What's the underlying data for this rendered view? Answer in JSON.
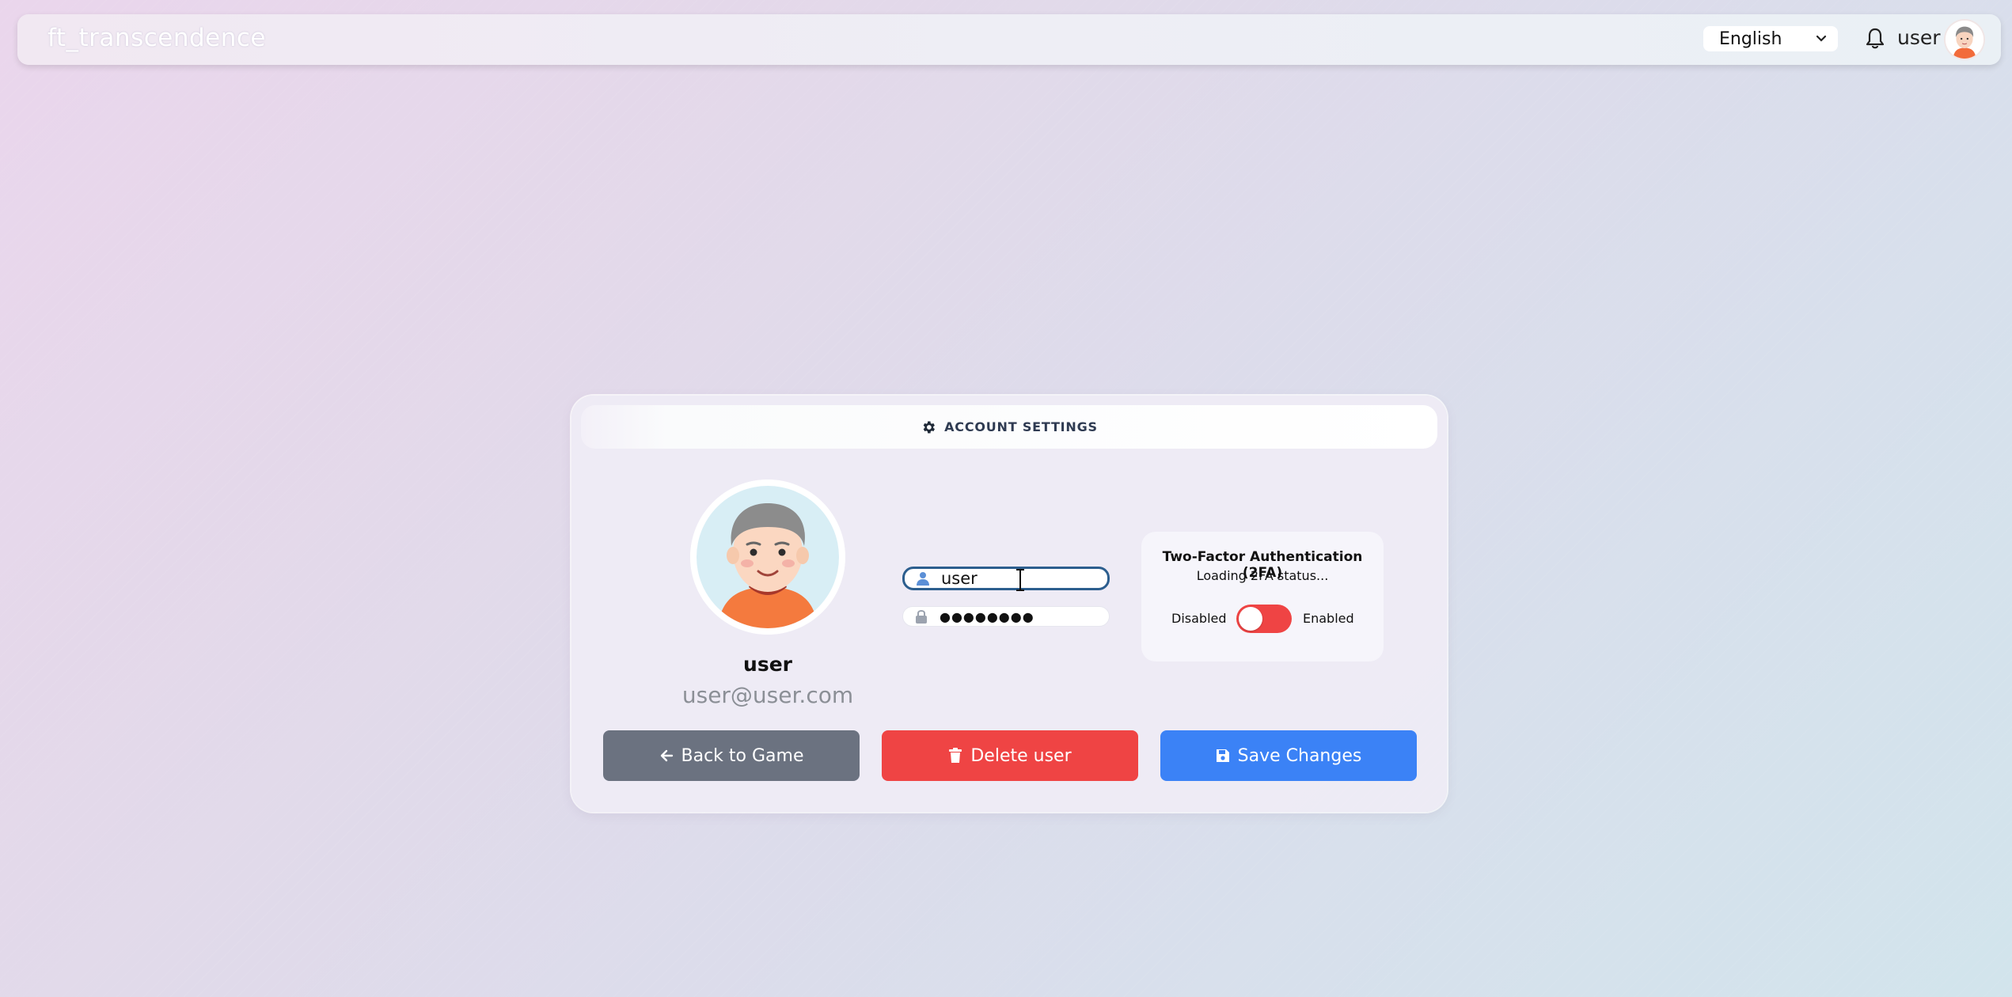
{
  "navbar": {
    "brand": "ft_transcendence",
    "language": {
      "selected": "English"
    },
    "notification_icon": "bell-icon",
    "username": "user"
  },
  "account_settings": {
    "header": {
      "title": "ACCOUNT SETTINGS",
      "icon": "gear-icon"
    },
    "profile": {
      "name": "user",
      "email": "user@user.com"
    },
    "form": {
      "username": {
        "value": "user",
        "icon": "user-icon"
      },
      "password": {
        "value": "●●●●●●●●",
        "icon": "lock-icon"
      }
    },
    "two_factor": {
      "title": "Two-Factor Authentication (2FA)",
      "status": "Loading 2FA status...",
      "disabled_label": "Disabled",
      "enabled_label": "Enabled",
      "enabled": false
    },
    "buttons": {
      "back_label": "Back to Game",
      "delete_label": "Delete user",
      "save_label": "Save Changes"
    }
  },
  "colors": {
    "back_button": "#6b7280",
    "delete_button": "#ef4444",
    "save_button": "#3b82f6",
    "toggle_off": "#ef4444",
    "input_focus_border": "#2c5e8e"
  }
}
